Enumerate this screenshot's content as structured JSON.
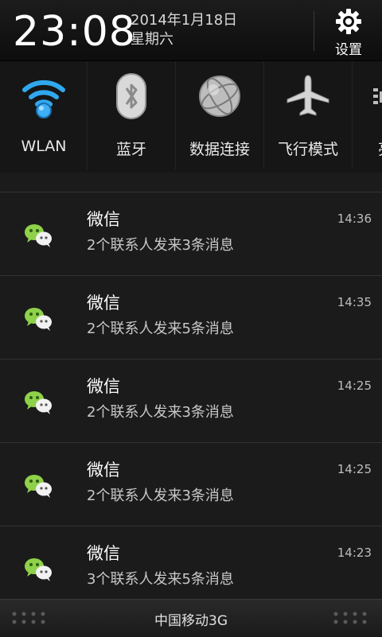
{
  "header": {
    "time": "23:08",
    "date": "2014年1月18日",
    "weekday": "星期六",
    "settings_label": "设置",
    "settings_icon": "gear-icon"
  },
  "toggles": [
    {
      "label": "WLAN",
      "icon": "wifi-icon",
      "active": true
    },
    {
      "label": "蓝牙",
      "icon": "bluetooth-icon",
      "active": false
    },
    {
      "label": "数据连接",
      "icon": "data-connection-icon",
      "active": false
    },
    {
      "label": "飞行模式",
      "icon": "airplane-icon",
      "active": false
    },
    {
      "label": "亮",
      "icon": "brightness-icon",
      "active": false
    }
  ],
  "accent_color": "#2c9be0",
  "notifications": [
    {
      "app": "微信",
      "message": "2个联系人发来3条消息",
      "time": "14:36"
    },
    {
      "app": "微信",
      "message": "2个联系人发来5条消息",
      "time": "14:35"
    },
    {
      "app": "微信",
      "message": "2个联系人发来3条消息",
      "time": "14:25"
    },
    {
      "app": "微信",
      "message": "2个联系人发来3条消息",
      "time": "14:25"
    },
    {
      "app": "微信",
      "message": "3个联系人发来5条消息",
      "time": "14:23"
    }
  ],
  "carrier": {
    "label": "中国移动3G"
  }
}
